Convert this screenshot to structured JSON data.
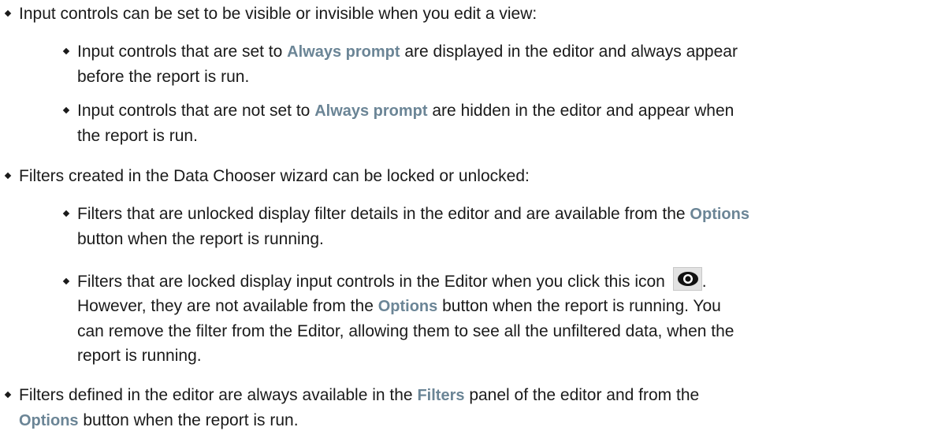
{
  "items": [
    {
      "text": "Input controls can be set to be visible or invisible when you edit a view:",
      "children": [
        {
          "pre": "Input controls that are set to ",
          "ui": "Always prompt",
          "post": " are displayed in the editor and always appear",
          "line2": "before the report is run."
        },
        {
          "pre": "Input controls that are not set to ",
          "ui": "Always prompt",
          "post": " are hidden in the editor and appear when",
          "line2": "the report is run."
        }
      ]
    },
    {
      "text": "Filters created in the Data Chooser wizard can be locked or unlocked:",
      "children": [
        {
          "pre": "Filters that are unlocked display filter details in the editor and are available from the ",
          "ui": "Options",
          "line2": "button when the report is running."
        },
        {
          "pre": "Filters that are locked display input controls in the Editor when you click this icon",
          "post": ".",
          "icon": "eye-icon",
          "line2_pre": "However, they are not available from the ",
          "line2_ui": "Options",
          "line2_post": " button when the report is running. You",
          "line3": "can remove the filter from the Editor, allowing them to see all the unfiltered data, when the",
          "line4": "report is running."
        }
      ]
    },
    {
      "pre": "Filters defined in the editor are always available in the ",
      "ui": "Filters",
      "post": " panel of the editor and from the",
      "line2_ui": "Options",
      "line2_post": " button when the report is run."
    }
  ],
  "colors": {
    "text": "#1a1a1a",
    "ui_term": "#6b8596",
    "icon_bg": "#e2e2e2"
  }
}
